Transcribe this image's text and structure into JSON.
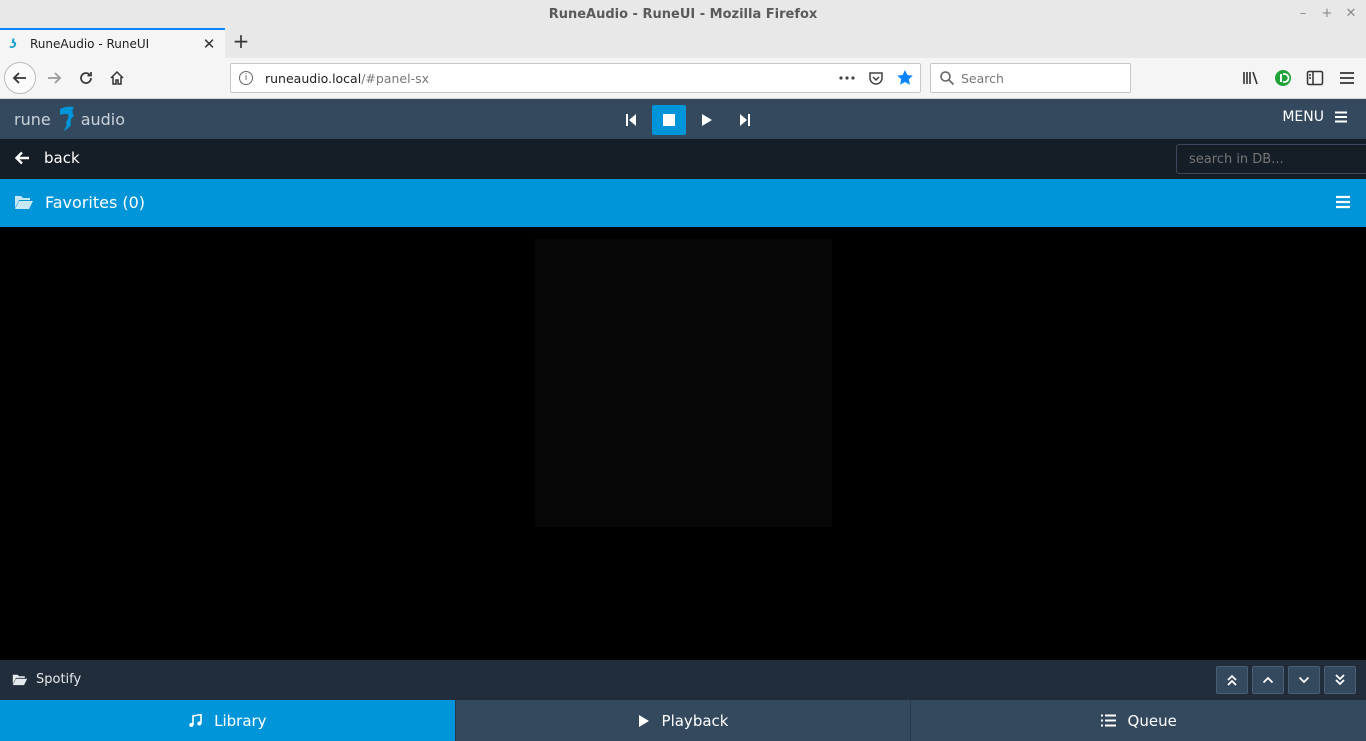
{
  "window": {
    "title": "RuneAudio - RuneUI - Mozilla Firefox",
    "controls": [
      "–",
      "+",
      "✕"
    ]
  },
  "browser": {
    "tab_title": "RuneAudio - RuneUI",
    "url_host": "runeaudio.local",
    "url_path": "/#panel-sx",
    "search_placeholder": "Search"
  },
  "app": {
    "logo_left": "rune",
    "logo_right": "audio",
    "menu_label": "MENU",
    "back_label": "back",
    "db_search_placeholder": "search in DB...",
    "section_title": "Favorites (0)",
    "footer_source": "Spotify",
    "tabs": [
      {
        "label": "Library",
        "icon": "music-icon"
      },
      {
        "label": "Playback",
        "icon": "play-icon"
      },
      {
        "label": "Queue",
        "icon": "list-icon"
      }
    ],
    "colors": {
      "accent": "#0095d8",
      "topbar": "#34495e",
      "dark": "#151d27"
    }
  }
}
